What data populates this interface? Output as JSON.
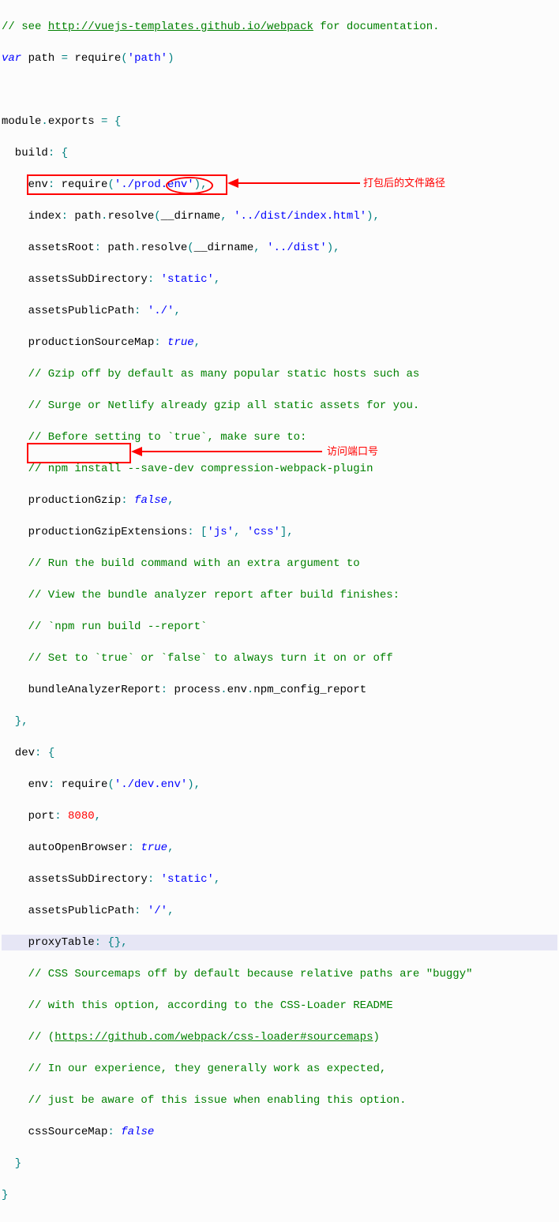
{
  "lines": {
    "l1a": "// see ",
    "l1b": "http://vuejs-templates.github.io/webpack",
    "l1c": " for documentation.",
    "l2a": "var",
    "l2b": " path ",
    "l2c": "=",
    "l2d": " require",
    "l2e": "(",
    "l2f": "'path'",
    "l2g": ")",
    "l4a": "module",
    "l4b": ".",
    "l4c": "exports ",
    "l4d": "=",
    "l4e": " {",
    "l5a": "  build",
    "l5b": ":",
    "l5c": " {",
    "l6a": "    env",
    "l6b": ":",
    "l6c": " require",
    "l6d": "(",
    "l6e": "'./prod.env'",
    "l6f": "),",
    "l7a": "    index",
    "l7b": ":",
    "l7c": " path",
    "l7d": ".",
    "l7e": "resolve",
    "l7f": "(",
    "l7g": "__dirname",
    "l7h": ", ",
    "l7i": "'../dist/index.html'",
    "l7j": "),",
    "l8a": "    assetsRoot",
    "l8b": ":",
    "l8c": " path",
    "l8d": ".",
    "l8e": "resolve",
    "l8f": "(",
    "l8g": "__dirname",
    "l8h": ", ",
    "l8i": "'../dist'",
    "l8j": "),",
    "l9a": "    assetsSubDirectory",
    "l9b": ":",
    "l9c": " ",
    "l9d": "'static'",
    "l9e": ",",
    "l10a": "    assetsPublicPath",
    "l10b": ":",
    "l10c": " ",
    "l10d": "'./'",
    "l10e": ",",
    "l11a": "    productionSourceMap",
    "l11b": ":",
    "l11c": " ",
    "l11d": "true",
    "l11e": ",",
    "l12": "    // Gzip off by default as many popular static hosts such as",
    "l13": "    // Surge or Netlify already gzip all static assets for you.",
    "l14": "    // Before setting to `true`, make sure to:",
    "l15": "    // npm install --save-dev compression-webpack-plugin",
    "l16a": "    productionGzip",
    "l16b": ":",
    "l16c": " ",
    "l16d": "false",
    "l16e": ",",
    "l17a": "    productionGzipExtensions",
    "l17b": ":",
    "l17c": " [",
    "l17d": "'js'",
    "l17e": ", ",
    "l17f": "'css'",
    "l17g": "],",
    "l18": "    // Run the build command with an extra argument to",
    "l19": "    // View the bundle analyzer report after build finishes:",
    "l20": "    // `npm run build --report`",
    "l21": "    // Set to `true` or `false` to always turn it on or off",
    "l22a": "    bundleAnalyzerReport",
    "l22b": ":",
    "l22c": " process",
    "l22d": ".",
    "l22e": "env",
    "l22f": ".",
    "l22g": "npm_config_report",
    "l23": "  },",
    "l24a": "  dev",
    "l24b": ":",
    "l24c": " {",
    "l25a": "    env",
    "l25b": ":",
    "l25c": " require",
    "l25d": "(",
    "l25e": "'./dev.env'",
    "l25f": "),",
    "l26a": "    port",
    "l26b": ":",
    "l26c": " ",
    "l26d": "8080",
    "l26e": ",",
    "l27a": "    autoOpenBrowser",
    "l27b": ":",
    "l27c": " ",
    "l27d": "true",
    "l27e": ",",
    "l28a": "    assetsSubDirectory",
    "l28b": ":",
    "l28c": " ",
    "l28d": "'static'",
    "l28e": ",",
    "l29a": "    assetsPublicPath",
    "l29b": ":",
    "l29c": " ",
    "l29d": "'/'",
    "l29e": ",",
    "l30a": "    proxyTable",
    "l30b": ":",
    "l30c": " {},",
    "l31": "    // CSS Sourcemaps off by default because relative paths are \"buggy\"",
    "l32": "    // with this option, according to the CSS-Loader README",
    "l33a": "    // (",
    "l33b": "https://github.com/webpack/css-loader#sourcemaps",
    "l33c": ")",
    "l34": "    // In our experience, they generally work as expected,",
    "l35": "    // just be aware of this issue when enabling this option.",
    "l36a": "    cssSourceMap",
    "l36b": ":",
    "l36c": " ",
    "l36d": "false",
    "l37": "  }",
    "l38": "}"
  },
  "annotations": {
    "a1": "打包后的文件路径",
    "a2": "访问端口号"
  }
}
